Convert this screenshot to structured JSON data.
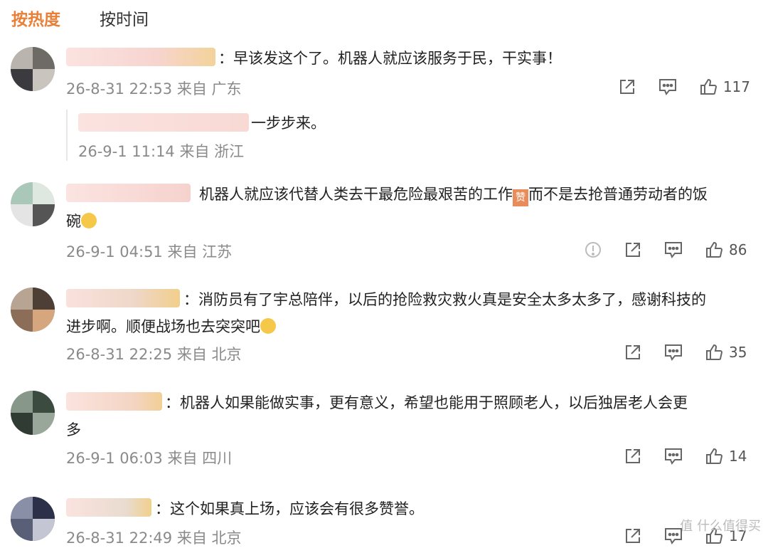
{
  "tabs": {
    "hot": "按热度",
    "time": "按时间"
  },
  "comments": [
    {
      "text": "：早该发这个了。机器人就应该服务于民，干实事！",
      "time": "26-8-31 22:53",
      "from": "来自 广东",
      "likes": "117",
      "reply": {
        "text": "一步步来。",
        "time": "26-9-1 11:14",
        "from": "来自 浙江"
      }
    },
    {
      "text_a": "机器人就应该代替人类去干最危险最艰苦的工作",
      "zan": "赞",
      "text_b": "而不是去抢普通劳动者的饭",
      "text_line2": "碗",
      "time": "26-9-1 04:51",
      "from": "来自 江苏",
      "likes": "86"
    },
    {
      "text_line1": "：消防员有了宇总陪伴，以后的抢险救灾救火真是安全太多太多了，感谢科技的",
      "text_line2": "进步啊。顺便战场也去突突吧",
      "time": "26-8-31 22:25",
      "from": "来自 北京",
      "likes": "35"
    },
    {
      "text_line1": "：机器人如果能做实事，更有意义，希望也能用于照顾老人，以后独居老人会更",
      "text_line2": "多",
      "time": "26-9-1 06:03",
      "from": "来自 四川",
      "likes": "14"
    },
    {
      "text": "：这个如果真上场，应该会有很多赞誉。",
      "time": "26-8-31 22:49",
      "from": "来自 北京",
      "likes": "17"
    }
  ],
  "watermark": "值 什么值得买",
  "icons": [
    "share-icon",
    "comment-icon",
    "like-icon",
    "report-icon"
  ],
  "colors": {
    "accent": "#e8803a",
    "meta": "#8a8a8a"
  }
}
